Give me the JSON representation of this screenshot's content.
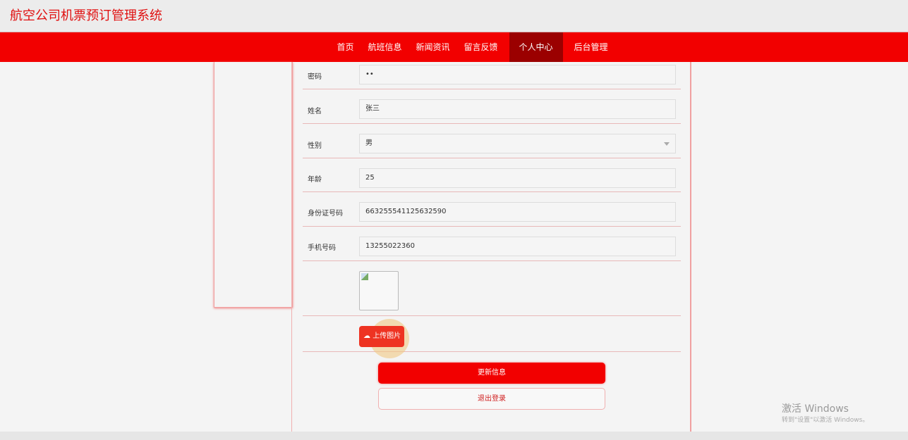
{
  "header": {
    "title": "航空公司机票预订管理系统"
  },
  "nav": [
    {
      "label": "首页"
    },
    {
      "label": "航班信息"
    },
    {
      "label": "新闻资讯"
    },
    {
      "label": "留言反馈"
    },
    {
      "label": "个人中心",
      "active": true
    },
    {
      "label": "后台管理"
    }
  ],
  "form": {
    "password": {
      "label": "密码",
      "value": "••"
    },
    "name": {
      "label": "姓名",
      "value": "张三"
    },
    "gender": {
      "label": "性别",
      "value": "男"
    },
    "age": {
      "label": "年龄",
      "value": "25"
    },
    "idcard": {
      "label": "身份证号码",
      "value": "663255541125632590"
    },
    "phone": {
      "label": "手机号码",
      "value": "13255022360"
    },
    "upload_label": "上传图片",
    "update_label": "更新信息",
    "logout_label": "退出登录"
  },
  "watermark": {
    "line1": "激活 Windows",
    "line2": "转到\"设置\"以激活 Windows。"
  },
  "colors": {
    "brand": "#f20000",
    "active_nav": "#9b0000"
  }
}
